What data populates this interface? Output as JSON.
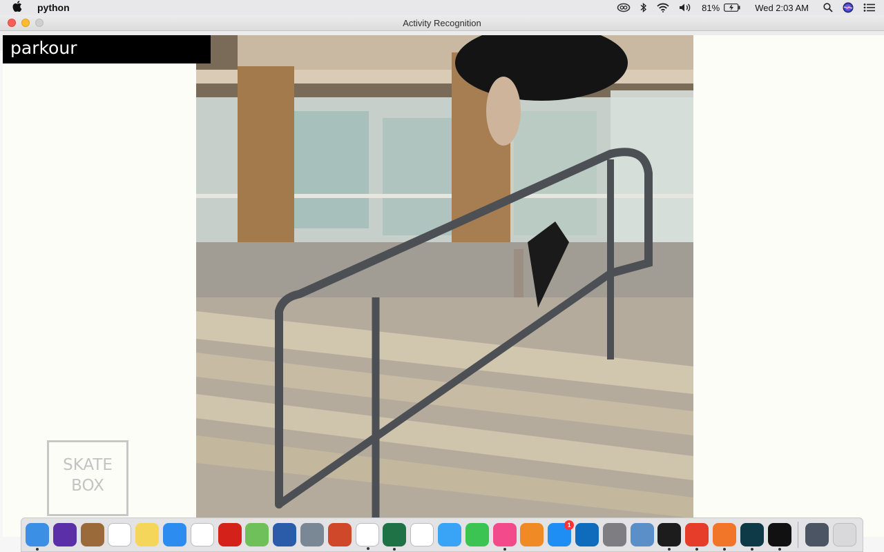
{
  "menubar": {
    "app_name": "python",
    "battery": "81%",
    "clock": "Wed 2:03 AM",
    "icons": [
      "creative-cloud-icon",
      "bluetooth-icon",
      "wifi-icon",
      "volume-icon",
      "battery-icon",
      "spotlight-icon",
      "siri-icon",
      "notification-center-icon"
    ]
  },
  "window": {
    "title": "Activity Recognition"
  },
  "overlay": {
    "label": "parkour"
  },
  "watermark": {
    "line1": "SKATE",
    "line2": "BOX"
  },
  "dock": {
    "apps": [
      {
        "name": "finder-icon",
        "color": "#3b8fe4",
        "running": true
      },
      {
        "name": "siri-icon",
        "color": "#5b2fa8",
        "running": false
      },
      {
        "name": "notebook-icon",
        "color": "#9b6a3a",
        "running": false
      },
      {
        "name": "calendar-icon",
        "color": "#ffffff",
        "running": false
      },
      {
        "name": "notes-icon",
        "color": "#f4d75a",
        "running": false
      },
      {
        "name": "safari-icon",
        "color": "#2d8cf0",
        "running": false
      },
      {
        "name": "reminders-icon",
        "color": "#ffffff",
        "running": false
      },
      {
        "name": "acrobat-icon",
        "color": "#d4221b",
        "running": false
      },
      {
        "name": "maps-icon",
        "color": "#6fbf5a",
        "running": false
      },
      {
        "name": "word-icon",
        "color": "#2a5caa",
        "running": false
      },
      {
        "name": "launchpad-icon",
        "color": "#7a8794",
        "running": false
      },
      {
        "name": "powerpoint-icon",
        "color": "#d0482a",
        "running": false
      },
      {
        "name": "chrome-icon",
        "color": "#ffffff",
        "running": true
      },
      {
        "name": "excel-icon",
        "color": "#1f7246",
        "running": true
      },
      {
        "name": "photos-icon",
        "color": "#ffffff",
        "running": false
      },
      {
        "name": "messages-icon",
        "color": "#39a3f5",
        "running": false
      },
      {
        "name": "facetime-icon",
        "color": "#3cc452",
        "running": false
      },
      {
        "name": "itunes-icon",
        "color": "#f24a8a",
        "running": true
      },
      {
        "name": "books-icon",
        "color": "#f08a24",
        "running": false
      },
      {
        "name": "app-store-icon",
        "color": "#1e8ef5",
        "running": false,
        "badge": "1"
      },
      {
        "name": "outlook-icon",
        "color": "#0f6cbd",
        "running": false
      },
      {
        "name": "system-preferences-icon",
        "color": "#7e7e82",
        "running": false
      },
      {
        "name": "preview-icon",
        "color": "#5a8fc7",
        "running": false
      },
      {
        "name": "terminal-icon",
        "color": "#1c1c1c",
        "running": true
      },
      {
        "name": "git-icon",
        "color": "#e63c2a",
        "running": true
      },
      {
        "name": "sublime-text-icon",
        "color": "#f1762a",
        "running": true
      },
      {
        "name": "filmora-icon",
        "color": "#0d3a46",
        "running": true
      },
      {
        "name": "exec-icon",
        "color": "#111111",
        "running": true
      }
    ],
    "trailing": [
      {
        "name": "recent-folder-icon",
        "color": "#4b5563"
      },
      {
        "name": "trash-icon",
        "color": "#d9d9dc"
      }
    ]
  }
}
